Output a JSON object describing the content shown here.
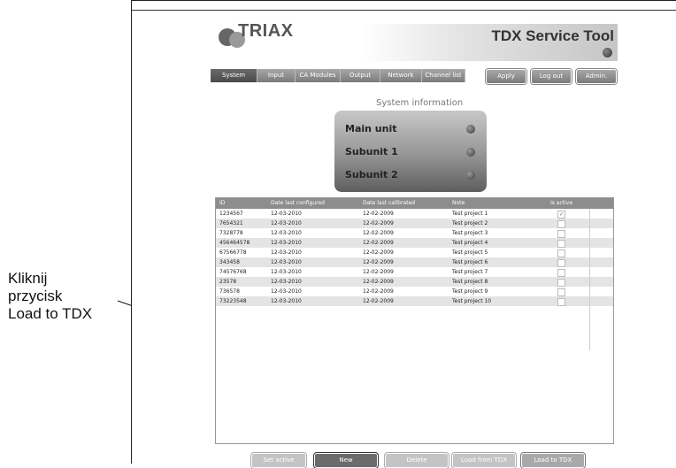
{
  "annotation": {
    "lines": [
      "Kliknij",
      "przycisk",
      "Load to TDX"
    ]
  },
  "header": {
    "logo_text": "TRIAX",
    "title": "TDX Service Tool"
  },
  "nav": {
    "tabs": [
      "System",
      "Input",
      "CA Modules",
      "Output",
      "Network",
      "Channel list"
    ],
    "active_tab": "System",
    "buttons": [
      "Apply",
      "Log out",
      "Admin."
    ]
  },
  "system_info": {
    "title": "System information",
    "units": [
      "Main unit",
      "Subunit 1",
      "Subunit 2"
    ]
  },
  "table": {
    "columns": [
      "ID",
      "Date last configured",
      "Date last calibrated",
      "Note",
      "Is active"
    ],
    "rows": [
      {
        "id": "1234567",
        "configured": "12-03-2010",
        "calibrated": "12-02-2009",
        "note": "Test project 1",
        "active": true
      },
      {
        "id": "7654321",
        "configured": "12-03-2010",
        "calibrated": "12-02-2009",
        "note": "Test project 2",
        "active": false
      },
      {
        "id": "7328778",
        "configured": "12-03-2010",
        "calibrated": "12-02-2009",
        "note": "Test project 3",
        "active": false
      },
      {
        "id": "456464578",
        "configured": "12-03-2010",
        "calibrated": "12-02-2009",
        "note": "Test project 4",
        "active": false
      },
      {
        "id": "67566778",
        "configured": "12-03-2010",
        "calibrated": "12-02-2009",
        "note": "Test project 5",
        "active": false
      },
      {
        "id": "343458",
        "configured": "12-03-2010",
        "calibrated": "12-02-2009",
        "note": "Test project 6",
        "active": false
      },
      {
        "id": "74576768",
        "configured": "12-03-2010",
        "calibrated": "12-02-2009",
        "note": "Test project 7",
        "active": false
      },
      {
        "id": "23578",
        "configured": "12-03-2010",
        "calibrated": "12-02-2009",
        "note": "Test project 8",
        "active": false
      },
      {
        "id": "736578",
        "configured": "12-03-2010",
        "calibrated": "12-02-2009",
        "note": "Test project 9",
        "active": false
      },
      {
        "id": "73223548",
        "configured": "12-03-2010",
        "calibrated": "12-02-2009",
        "note": "Test project 10",
        "active": false
      }
    ]
  },
  "bottom_buttons": {
    "set_active": "Set active",
    "new": "New",
    "delete": "Delete",
    "load_from_tdx": "Load from TDX",
    "load_to_tdx": "Load to TDX"
  },
  "colors": {
    "tab_active": "#555555",
    "tab": "#8e8e8e",
    "header_row": "#8d8d8d",
    "alt_row": "#e4e4e4"
  }
}
